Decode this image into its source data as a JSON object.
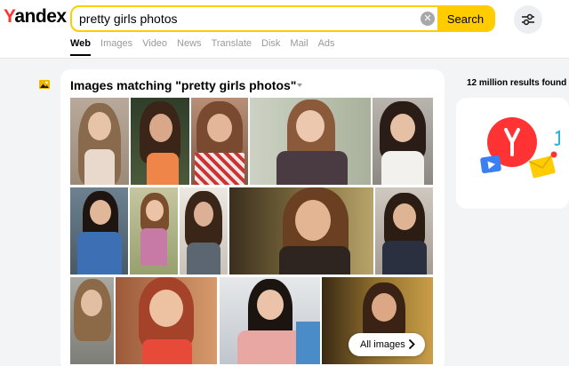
{
  "header": {
    "logo_first": "Y",
    "logo_rest": "andex",
    "search_value": "pretty girls photos",
    "search_button": "Search",
    "clear_icon": "close-icon",
    "settings_icon": "sliders-icon"
  },
  "tabs": [
    {
      "label": "Web",
      "active": true
    },
    {
      "label": "Images",
      "active": false
    },
    {
      "label": "Video",
      "active": false
    },
    {
      "label": "News",
      "active": false
    },
    {
      "label": "Translate",
      "active": false
    },
    {
      "label": "Disk",
      "active": false
    },
    {
      "label": "Mail",
      "active": false
    },
    {
      "label": "Ads",
      "active": false
    }
  ],
  "images_block": {
    "title": "Images matching \"pretty girls photos\"",
    "all_images_label": "All images",
    "icon": "picture-icon"
  },
  "sidebar": {
    "results_count": "12 million results found"
  },
  "colors": {
    "accent": "#ffcc00",
    "brand_red": "#ff3333"
  }
}
